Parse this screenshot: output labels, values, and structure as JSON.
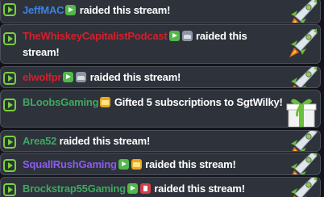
{
  "alerts": [
    {
      "user": "JeffMAC",
      "user_color": "#3b82e0",
      "badges": [
        "green"
      ],
      "text": "raided this stream!",
      "icon": "rocket-icon"
    },
    {
      "user": "TheWhiskeyCapitalistPodcast",
      "user_color": "#d4202c",
      "badges": [
        "green",
        "gray"
      ],
      "text": "raided this stream!",
      "icon": "rocket-icon"
    },
    {
      "user": "elwolfpr",
      "user_color": "#d4202c",
      "badges": [
        "green",
        "gray"
      ],
      "text": "raided this stream!",
      "icon": "rocket-icon"
    },
    {
      "user": "BLoobsGaming",
      "user_color": "#3fa860",
      "badges": [
        "gold"
      ],
      "text": "Gifted 5 subscriptions to SgtWilky!",
      "icon": "gift-icon"
    },
    {
      "user": "Area52",
      "user_color": "#3fa860",
      "badges": [],
      "text": "raided this stream!",
      "icon": "rocket-icon"
    },
    {
      "user": "SquallRushGaming",
      "user_color": "#8a5cf0",
      "badges": [
        "green",
        "gold"
      ],
      "text": "raided this stream!",
      "icon": "rocket-icon"
    },
    {
      "user": "Brockstrap55Gaming",
      "user_color": "#3fa860",
      "badges": [
        "green",
        "red"
      ],
      "text": "raided this stream!",
      "icon": "rocket-icon"
    }
  ],
  "colors": {
    "accent_green": "#7ad03e",
    "card_bg": "#2e323b",
    "card_border": "#4b505a",
    "page_bg": "#12141a"
  }
}
